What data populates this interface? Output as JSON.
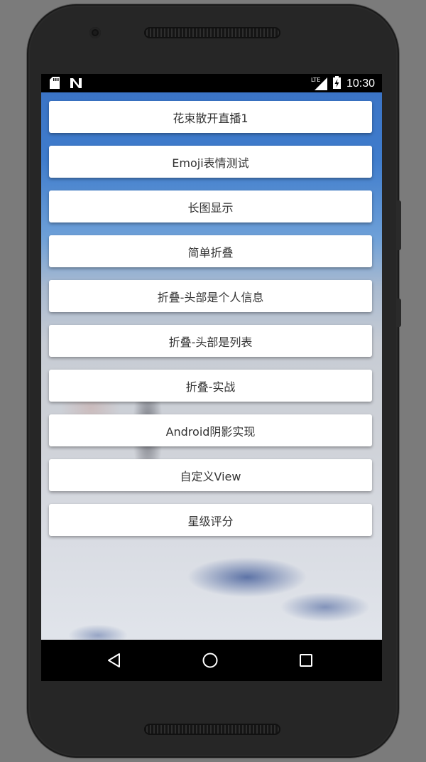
{
  "status_bar": {
    "time": "10:30",
    "network_label": "LTE",
    "icons": [
      "sd-card-icon",
      "n-notification-icon",
      "lte-signal-icon",
      "battery-charging-icon"
    ]
  },
  "menu": {
    "items": [
      {
        "label": "花束散开直播1"
      },
      {
        "label": "Emoji表情测试"
      },
      {
        "label": "长图显示"
      },
      {
        "label": "简单折叠"
      },
      {
        "label": "折叠-头部是个人信息"
      },
      {
        "label": "折叠-头部是列表"
      },
      {
        "label": "折叠-实战"
      },
      {
        "label": "Android阴影实现"
      },
      {
        "label": "自定义View"
      },
      {
        "label": "星级评分"
      }
    ]
  },
  "nav_bar": {
    "icons": [
      "back-icon",
      "home-icon",
      "recents-icon"
    ]
  },
  "colors": {
    "button_bg": "#ffffff",
    "button_text": "#333333",
    "bar_bg": "#000000",
    "wallpaper_top": "#3a72c4"
  }
}
